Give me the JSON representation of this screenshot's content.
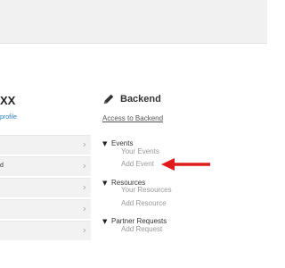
{
  "profile": {
    "title": "XX",
    "link": "profile"
  },
  "menu": {
    "items": [
      {
        "label": ""
      },
      {
        "label": "d"
      },
      {
        "label": ""
      },
      {
        "label": ""
      },
      {
        "label": ""
      }
    ]
  },
  "backend": {
    "icon": "pencil-icon",
    "title": "Backend",
    "access_link": "Access to Backend",
    "tree": [
      {
        "label": "Events",
        "children": [
          "Your Events",
          "Add Event"
        ]
      },
      {
        "label": "Resources",
        "children": [
          "Your Resources",
          "Add Resource"
        ]
      },
      {
        "label": "Partner Requests",
        "children": [
          "Add Request"
        ]
      }
    ]
  },
  "annotation": {
    "arrow_color": "#e01b1b",
    "icon": "arrow-left-icon"
  }
}
